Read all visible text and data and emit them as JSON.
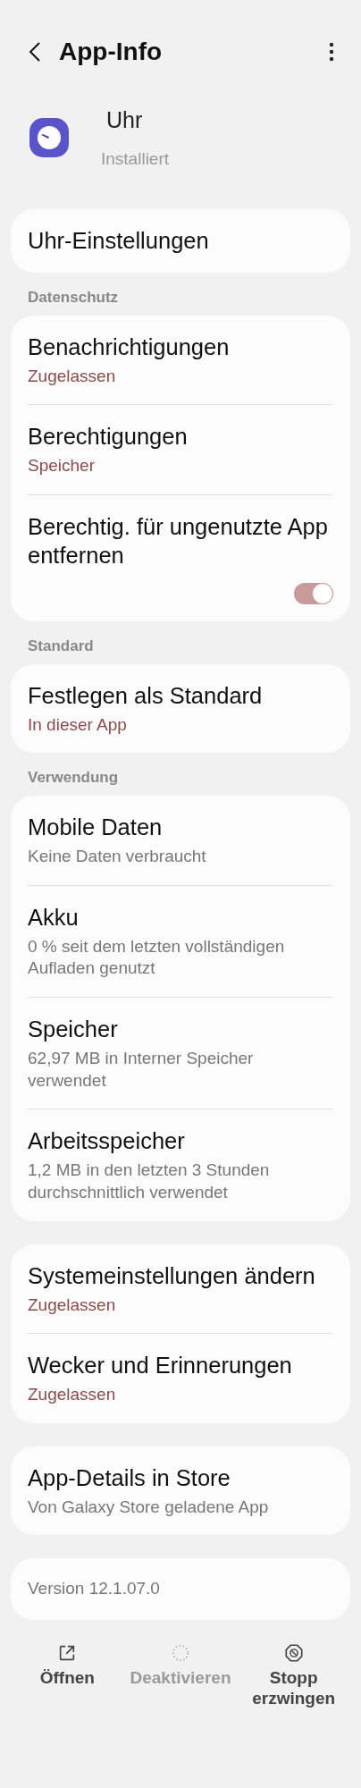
{
  "header": {
    "title": "App-Info"
  },
  "app": {
    "name": "Uhr",
    "status": "Installiert"
  },
  "groups": [
    {
      "items": [
        {
          "title": "Uhr-Einstellungen"
        }
      ]
    },
    {
      "label": "Datenschutz",
      "items": [
        {
          "title": "Benachrichtigungen",
          "subtitle": "Zugelassen",
          "accent": true
        },
        {
          "title": "Berechtigungen",
          "subtitle": "Speicher",
          "accent": true
        },
        {
          "title": "Berechtig. für ungenutzte App entfernen",
          "kind": "toggle",
          "on": true
        }
      ]
    },
    {
      "label": "Standard",
      "items": [
        {
          "title": "Festlegen als Standard",
          "subtitle": "In dieser App",
          "accent": true
        }
      ]
    },
    {
      "label": "Verwendung",
      "items": [
        {
          "title": "Mobile Daten",
          "subtitle": "Keine Daten verbraucht",
          "accent": false
        },
        {
          "title": "Akku",
          "subtitle": "0 % seit dem letzten vollständigen Aufladen genutzt",
          "accent": false
        },
        {
          "title": "Speicher",
          "subtitle": "62,97 MB in Interner Speicher verwendet",
          "accent": false
        },
        {
          "title": "Arbeitsspeicher",
          "subtitle": "1,2 MB in den letzten 3 Stunden durchschnittlich verwendet",
          "accent": false
        }
      ]
    },
    {
      "items": [
        {
          "title": "Systemeinstellungen ändern",
          "subtitle": "Zugelassen",
          "accent": true
        },
        {
          "title": "Wecker und Erinnerungen",
          "subtitle": "Zugelassen",
          "accent": true
        }
      ]
    },
    {
      "items": [
        {
          "title": "App-Details in Store",
          "subtitle": "Von Galaxy Store geladene App",
          "accent": false
        }
      ]
    },
    {
      "items": [
        {
          "title": "Version 12.1.07.0",
          "kind": "info"
        }
      ]
    }
  ],
  "actions": [
    {
      "kind": "open",
      "label": "Öffnen",
      "disabled": false
    },
    {
      "kind": "disable",
      "label": "Deaktivieren",
      "disabled": true
    },
    {
      "kind": "stop",
      "label": "Stopp erzwingen",
      "disabled": false
    }
  ]
}
